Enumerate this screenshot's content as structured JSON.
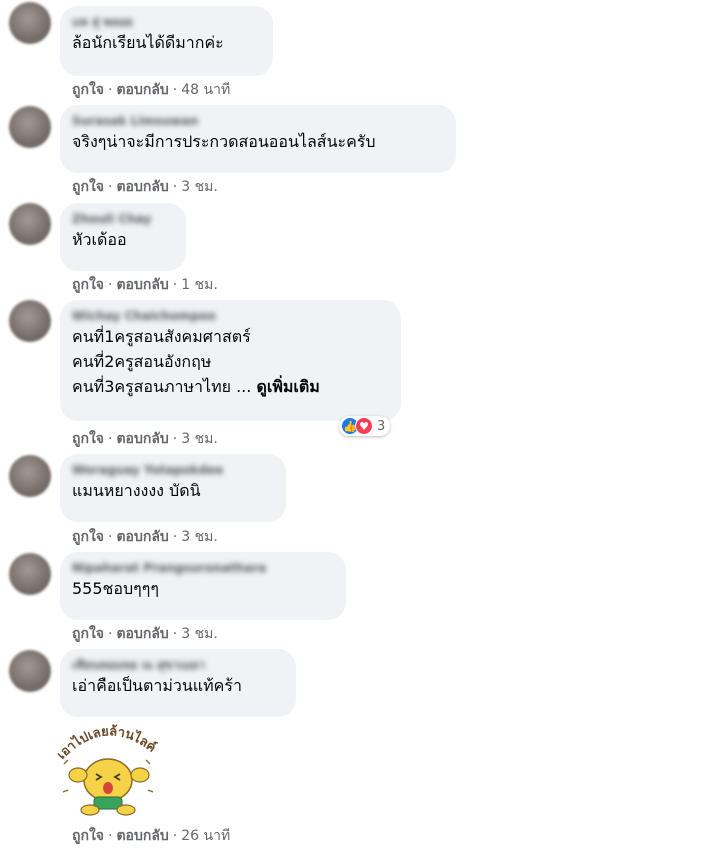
{
  "comments": [
    {
      "author": "แพ สุ่ พลอย",
      "lines": [
        "ล้อนักเรียนได้ดีมากค่ะ"
      ],
      "like": "ถูกใจ",
      "reply": "ตอบกลับ",
      "time": "48 นาที"
    },
    {
      "author": "Surasak Limsuwan",
      "lines": [
        "จริงๆน่าจะมีการประกวดสอนออนไลส์นะครับ"
      ],
      "like": "ถูกใจ",
      "reply": "ตอบกลับ",
      "time": "3 ชม."
    },
    {
      "author": "Zhouli Chay",
      "lines": [
        "หัวเด้ออ"
      ],
      "like": "ถูกใจ",
      "reply": "ตอบกลับ",
      "time": "1 ชม."
    },
    {
      "author": "Wichay Chaichompoo",
      "lines": [
        "คนที่1ครูสอนสังคมศาสตร์",
        "คนที่2ครูสอนอังกฤษ",
        "คนที่3ครูสอนภาษาไทย ..."
      ],
      "see_more": "ดูเพิ่มเติม",
      "like": "ถูกใจ",
      "reply": "ตอบกลับ",
      "time": "3 ชม.",
      "reactions": {
        "count": "3",
        "icons": [
          "like-icon",
          "love-icon"
        ]
      }
    },
    {
      "author": "Woraguay Yotapokdee",
      "lines": [
        "แมนหยางงงง บัดนิ"
      ],
      "like": "ถูกใจ",
      "reply": "ตอบกลับ",
      "time": "3 ชม."
    },
    {
      "author": "Nipaharat Prangsuronathara",
      "lines": [
        "555ชอบๆๆๆ"
      ],
      "like": "ถูกใจ",
      "reply": "ตอบกลับ",
      "time": "3 ชม."
    },
    {
      "author": "เทียนหอมหอ ณ สุขาเมยา",
      "lines": [
        "เอ่าคือเป็นตาม่วนแท้คร้า"
      ],
      "like": "ถูกใจ",
      "reply": "ตอบกลับ",
      "time": "26 นาที",
      "sticker": {
        "text": "เอาไปเลยล้านไลค์"
      }
    }
  ],
  "colors": {
    "bubble": "#f0f2f5",
    "meta": "#65676b",
    "like": "#1877f2",
    "love": "#f33e58",
    "sticker_shirt": "#3aa55a",
    "sticker_face": "#f6d247"
  }
}
